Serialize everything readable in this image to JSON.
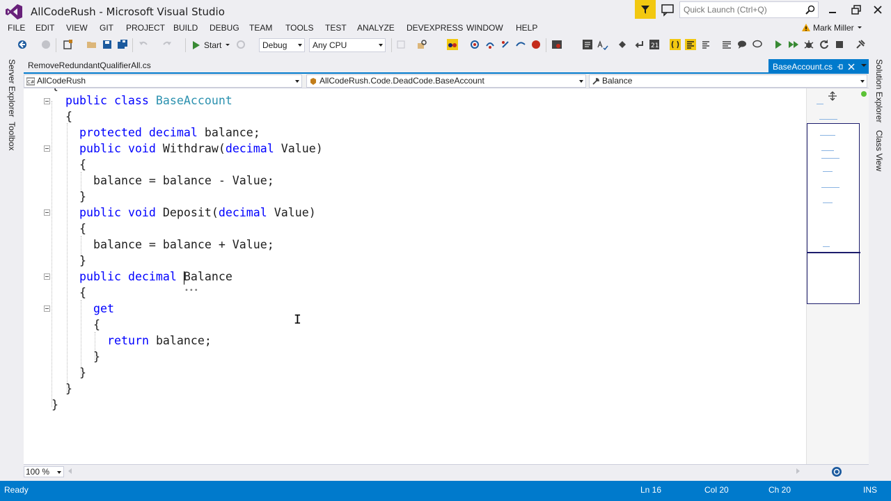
{
  "window": {
    "title": "AllCodeRush - Microsoft Visual Studio",
    "quick_launch_placeholder": "Quick Launch (Ctrl+Q)",
    "user": "Mark Miller"
  },
  "menu": [
    "FILE",
    "EDIT",
    "VIEW",
    "GIT",
    "PROJECT",
    "BUILD",
    "DEBUG",
    "TEAM",
    "TOOLS",
    "TEST",
    "ANALYZE",
    "DEVEXPRESS",
    "WINDOW",
    "HELP"
  ],
  "toolbar": {
    "start_label": "Start",
    "configuration": "Debug",
    "platform": "Any CPU"
  },
  "side_tabs": {
    "left": [
      "Server Explorer",
      "Toolbox"
    ],
    "right": [
      "Solution Explorer",
      "Class View"
    ]
  },
  "doc_tabs": {
    "inactive": "RemoveRedundantQualifierAll.cs",
    "active": "BaseAccount.cs"
  },
  "nav": {
    "project": "AllCodeRush",
    "type": "AllCodeRush.Code.DeadCode.BaseAccount",
    "member": "Balance"
  },
  "code_lines": [
    "{",
    "public class BaseAccount",
    "{",
    "protected decimal balance;",
    "public void Withdraw(decimal Value)",
    "{",
    "balance = balance - Value;",
    "}",
    "public void Deposit(decimal Value)",
    "{",
    "balance = balance + Value;",
    "}",
    "public decimal Balance",
    "{",
    "get",
    "{",
    "return balance;",
    "}",
    "}",
    "}",
    "}"
  ],
  "editor": {
    "zoom": "100 %"
  },
  "status": {
    "state": "Ready",
    "line": "Ln 16",
    "col": "Col 20",
    "ch": "Ch 20",
    "mode": "INS"
  },
  "colors": {
    "accent": "#007acc",
    "keyword": "#0000ff",
    "type": "#2b91af"
  }
}
